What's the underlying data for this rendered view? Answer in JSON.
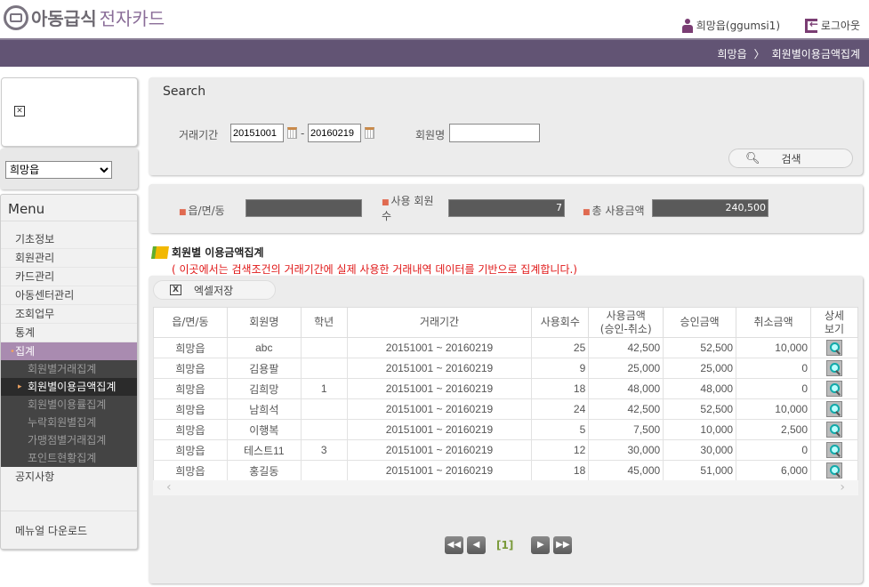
{
  "header": {
    "logo_main": "아동급식",
    "logo_sub": "전자카드",
    "user": "희망읍(ggumsi1)",
    "logout": "로그아웃"
  },
  "breadcrumb": {
    "items": [
      "희망읍",
      "회원별이용금액집계"
    ],
    "separator": "〉"
  },
  "sidebar": {
    "town_select": "희망읍",
    "menu_title": "Menu",
    "items": [
      "기초정보",
      "회원관리",
      "카드관리",
      "아동센터관리",
      "조회업무",
      "통계",
      "집계"
    ],
    "sub_items": [
      "회원별거래집계",
      "회원별이용금액집계",
      "회원별이용률집계",
      "누락회원별집계",
      "가맹점별거래집계",
      "포인트현황집계"
    ],
    "active_sub": "회원별이용금액집계",
    "notice": "공지사항",
    "manual": "메뉴얼 다운로드"
  },
  "search": {
    "title": "Search",
    "period_label": "거래기간",
    "date_from": "20151001",
    "date_sep": "-",
    "date_to": "20160219",
    "member_label": "회원명",
    "member_value": "",
    "search_btn": "검색"
  },
  "summary": {
    "town_label": "읍/면/동",
    "town_value": "",
    "members_label": "사용 회원수",
    "members_value": "7",
    "total_label": "총 사용금액",
    "total_value": "240,500"
  },
  "section": {
    "title": "회원별 이용금액집계",
    "note": "( 이곳에서는 검색조건의 거래기간에 실제 사용한 거래내역 데이터를 기반으로 집계합니다.)",
    "excel_btn": "엑셀저장"
  },
  "table": {
    "headers": [
      "읍/면/동",
      "회원명",
      "학년",
      "거래기간",
      "사용회수",
      "사용금액\n(승인-취소)",
      "승인금액",
      "취소금액",
      "상세\n보기"
    ],
    "rows": [
      [
        "희망읍",
        "abc",
        "",
        "20151001 ~ 20160219",
        "25",
        "42,500",
        "52,500",
        "10,000"
      ],
      [
        "희망읍",
        "김용팔",
        "",
        "20151001 ~ 20160219",
        "9",
        "25,000",
        "25,000",
        "0"
      ],
      [
        "희망읍",
        "김희망",
        "1",
        "20151001 ~ 20160219",
        "18",
        "48,000",
        "48,000",
        "0"
      ],
      [
        "희망읍",
        "남희석",
        "",
        "20151001 ~ 20160219",
        "24",
        "42,500",
        "52,500",
        "10,000"
      ],
      [
        "희망읍",
        "이행복",
        "",
        "20151001 ~ 20160219",
        "5",
        "7,500",
        "10,000",
        "2,500"
      ],
      [
        "희망읍",
        "테스트11",
        "3",
        "20151001 ~ 20160219",
        "12",
        "30,000",
        "30,000",
        "0"
      ],
      [
        "희망읍",
        "홍길동",
        "",
        "20151001 ~ 20160219",
        "18",
        "45,000",
        "51,000",
        "6,000"
      ]
    ]
  },
  "pagination": {
    "current": "[1]"
  }
}
